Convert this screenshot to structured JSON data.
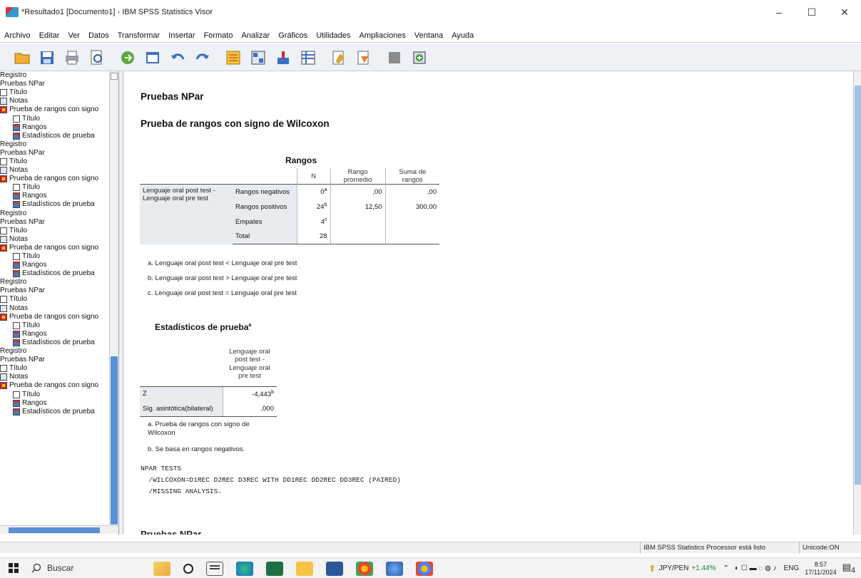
{
  "window": {
    "title": "*Resultado1 [Documento1] - IBM SPSS Statistics Visor",
    "minimize": "–",
    "maximize": "☐",
    "close": "✕"
  },
  "menu": [
    "Archivo",
    "Editar",
    "Ver",
    "Datos",
    "Transformar",
    "Insertar",
    "Formato",
    "Analizar",
    "Gráficos",
    "Utilidades",
    "Ampliaciones",
    "Ventana",
    "Ayuda"
  ],
  "toolbar_icons": [
    "open-icon",
    "save-icon",
    "print-icon",
    "print-preview-icon",
    "export-icon",
    "recall-dialog-icon",
    "undo-icon",
    "redo-icon",
    "goto-data-icon",
    "goto-case-icon",
    "variables-icon",
    "select-cases-icon",
    "designate-window-icon",
    "script-icon",
    "hide-icon",
    "promote-icon"
  ],
  "outline": {
    "items": [
      {
        "label": "Registro",
        "icon": "none",
        "level": 1
      },
      {
        "label": "Pruebas NPar",
        "icon": "none",
        "level": 1
      },
      {
        "label": "Título",
        "icon": "title",
        "level": 1
      },
      {
        "label": "Notas",
        "icon": "notes",
        "level": 1
      },
      {
        "label": "Prueba de rangos con signo",
        "icon": "proc",
        "level": 1
      },
      {
        "label": "Título",
        "icon": "title",
        "level": 2
      },
      {
        "label": "Rangos",
        "icon": "table",
        "level": 2
      },
      {
        "label": "Estadísticos de prueba",
        "icon": "table",
        "level": 2
      },
      {
        "label": "Registro",
        "icon": "none",
        "level": 1
      },
      {
        "label": "Pruebas NPar",
        "icon": "none",
        "level": 1
      },
      {
        "label": "Título",
        "icon": "title",
        "level": 1
      },
      {
        "label": "Notas",
        "icon": "notes",
        "level": 1
      },
      {
        "label": "Prueba de rangos con signo",
        "icon": "proc",
        "level": 1
      },
      {
        "label": "Título",
        "icon": "title",
        "level": 2
      },
      {
        "label": "Rangos",
        "icon": "table",
        "level": 2
      },
      {
        "label": "Estadísticos de prueba",
        "icon": "table",
        "level": 2
      },
      {
        "label": "Registro",
        "icon": "none",
        "level": 1
      },
      {
        "label": "Pruebas NPar",
        "icon": "none",
        "level": 1
      },
      {
        "label": "Título",
        "icon": "title",
        "level": 1
      },
      {
        "label": "Notas",
        "icon": "notes",
        "level": 1
      },
      {
        "label": "Prueba de rangos con signo",
        "icon": "proc",
        "level": 1
      },
      {
        "label": "Título",
        "icon": "title",
        "level": 2
      },
      {
        "label": "Rangos",
        "icon": "table",
        "level": 2
      },
      {
        "label": "Estadísticos de prueba",
        "icon": "table",
        "level": 2
      },
      {
        "label": "Registro",
        "icon": "none",
        "level": 1
      },
      {
        "label": "Pruebas NPar",
        "icon": "none",
        "level": 1
      },
      {
        "label": "Título",
        "icon": "title",
        "level": 1
      },
      {
        "label": "Notas",
        "icon": "notes",
        "level": 1
      },
      {
        "label": "Prueba de rangos con signo",
        "icon": "proc",
        "level": 1
      },
      {
        "label": "Título",
        "icon": "title",
        "level": 2
      },
      {
        "label": "Rangos",
        "icon": "table",
        "level": 2
      },
      {
        "label": "Estadísticos de prueba",
        "icon": "table",
        "level": 2
      },
      {
        "label": "Registro",
        "icon": "none",
        "level": 1
      },
      {
        "label": "Pruebas NPar",
        "icon": "none",
        "level": 1
      },
      {
        "label": "Título",
        "icon": "title",
        "level": 1
      },
      {
        "label": "Notas",
        "icon": "notes",
        "level": 1
      },
      {
        "label": "Prueba de rangos con signo",
        "icon": "proc",
        "level": 1
      },
      {
        "label": "Título",
        "icon": "title",
        "level": 2
      },
      {
        "label": "Rangos",
        "icon": "table",
        "level": 2
      },
      {
        "label": "Estadísticos de prueba",
        "icon": "table",
        "level": 2
      }
    ]
  },
  "output": {
    "heading_npar": "Pruebas NPar",
    "heading_wilcoxon": "Prueba de rangos con signo de Wilcoxon",
    "ranks": {
      "title": "Rangos",
      "col_n": "N",
      "col_avg": "Rango promedio",
      "col_sum": "Suma de rangos",
      "row_label": "Lenguaje oral post test - Lenguaje oral pre test",
      "rows": [
        {
          "label": "Rangos negativos",
          "n": "0",
          "sup": "a",
          "avg": ",00",
          "sum": ",00"
        },
        {
          "label": "Rangos positivos",
          "n": "24",
          "sup": "b",
          "avg": "12,50",
          "sum": "300,00"
        },
        {
          "label": "Empates",
          "n": "4",
          "sup": "c",
          "avg": "",
          "sum": ""
        },
        {
          "label": "Total",
          "n": "28",
          "sup": "",
          "avg": "",
          "sum": ""
        }
      ],
      "footnotes": [
        "a. Lenguaje oral post test  < Lenguaje oral pre test",
        "b. Lenguaje oral post test  > Lenguaje oral pre test",
        "c. Lenguaje oral post test  = Lenguaje oral pre test"
      ]
    },
    "test_stats": {
      "title": "Estadísticos de prueba",
      "title_sup": "a",
      "col_header": "Lenguaje oral post test - Lenguaje oral pre test",
      "rows": [
        {
          "label": "Z",
          "value": "-4,443",
          "sup": "b"
        },
        {
          "label": "Sig. asintótica(bilateral)",
          "value": ",000",
          "sup": ""
        }
      ],
      "footnote_a": "a. Prueba de rangos con signo de Wilcoxon",
      "footnote_b": "b. Se basa en rangos negativos."
    },
    "syntax": "NPAR TESTS\n  /WILCOXON=D1REC D2REC D3REC WITH DD1REC DD2REC DD3REC (PAIRED)\n  /MISSING ANALYSIS.",
    "next_heading": "Pruebas NPar"
  },
  "status": {
    "processor": "IBM SPSS Statistics Processor está listo",
    "unicode": "Unicode:ON"
  },
  "taskbar": {
    "search_placeholder": "Buscar",
    "ticker": "JPY/PEN",
    "ticker_change": "+1.44%",
    "lang": "ENG",
    "time": "8:57",
    "date": "17/11/2024",
    "notifications": "4"
  }
}
